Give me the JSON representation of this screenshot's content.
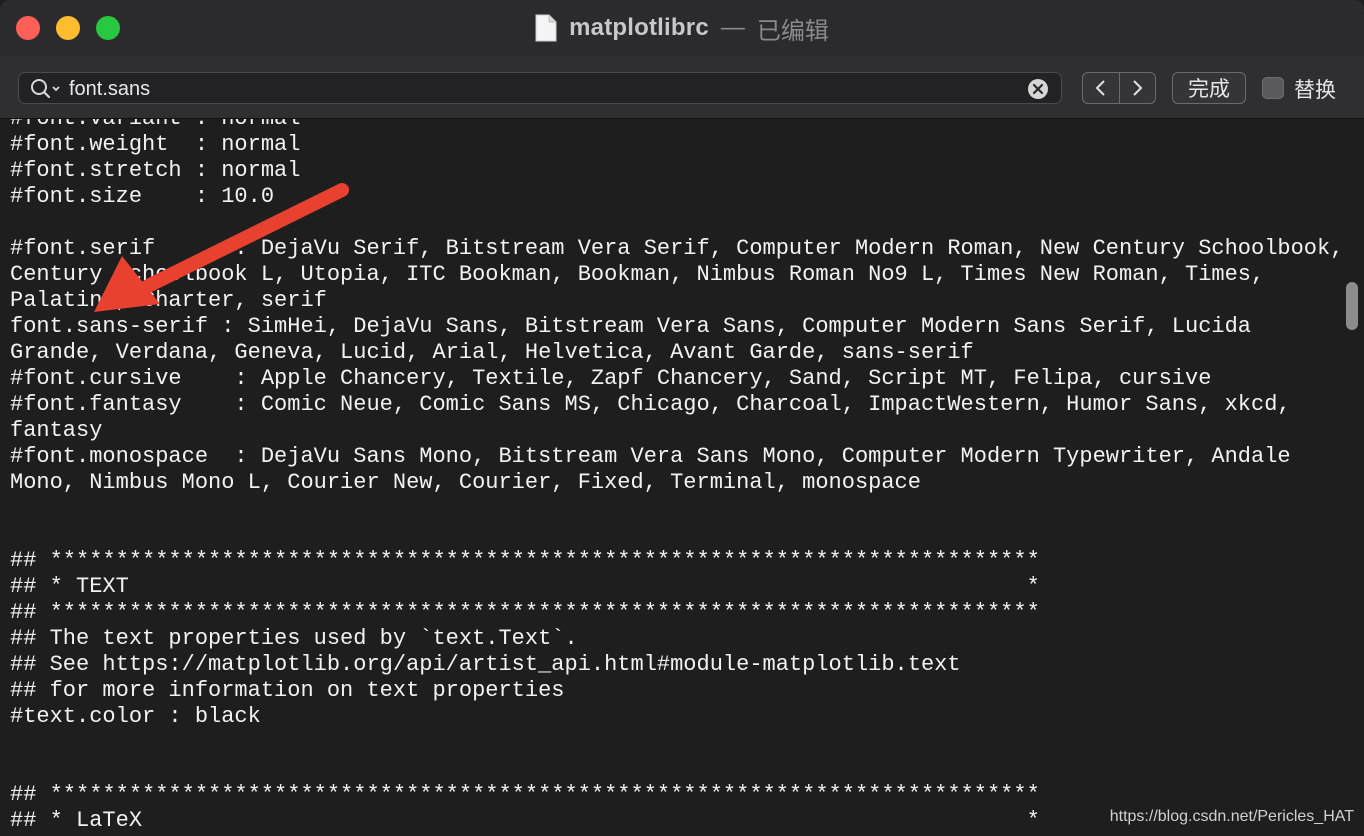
{
  "window": {
    "title": "matplotlibrc",
    "title_separator": "—",
    "status": "已编辑"
  },
  "findbar": {
    "search_value": "font.sans",
    "done_label": "完成",
    "replace_label": "替换",
    "replace_checked": false
  },
  "editor": {
    "lines": [
      "#font.variant : normal",
      "#font.weight  : normal",
      "#font.stretch : normal",
      "#font.size    : 10.0",
      "",
      "#font.serif      : DejaVu Serif, Bitstream Vera Serif, Computer Modern Roman, New Century Schoolbook,",
      "Century Schoolbook L, Utopia, ITC Bookman, Bookman, Nimbus Roman No9 L, Times New Roman, Times,",
      "Palatino, Charter, serif",
      "font.sans-serif : SimHei, DejaVu Sans, Bitstream Vera Sans, Computer Modern Sans Serif, Lucida",
      "Grande, Verdana, Geneva, Lucid, Arial, Helvetica, Avant Garde, sans-serif",
      "#font.cursive    : Apple Chancery, Textile, Zapf Chancery, Sand, Script MT, Felipa, cursive",
      "#font.fantasy    : Comic Neue, Comic Sans MS, Chicago, Charcoal, ImpactWestern, Humor Sans, xkcd,",
      "fantasy",
      "#font.monospace  : DejaVu Sans Mono, Bitstream Vera Sans Mono, Computer Modern Typewriter, Andale",
      "Mono, Nimbus Mono L, Courier New, Courier, Fixed, Terminal, monospace",
      "",
      "",
      "## ***************************************************************************",
      "## * TEXT                                                                    *",
      "## ***************************************************************************",
      "## The text properties used by `text.Text`.",
      "## See https://matplotlib.org/api/artist_api.html#module-matplotlib.text",
      "## for more information on text properties",
      "#text.color : black",
      "",
      "",
      "## ***************************************************************************",
      "## * LaTeX                                                                   *"
    ]
  },
  "watermark": "https://blog.csdn.net/Pericles_HAT",
  "colors": {
    "arrow": "#e8412f",
    "editor_bg": "#1e1e1e",
    "text": "#f2f2f2"
  }
}
